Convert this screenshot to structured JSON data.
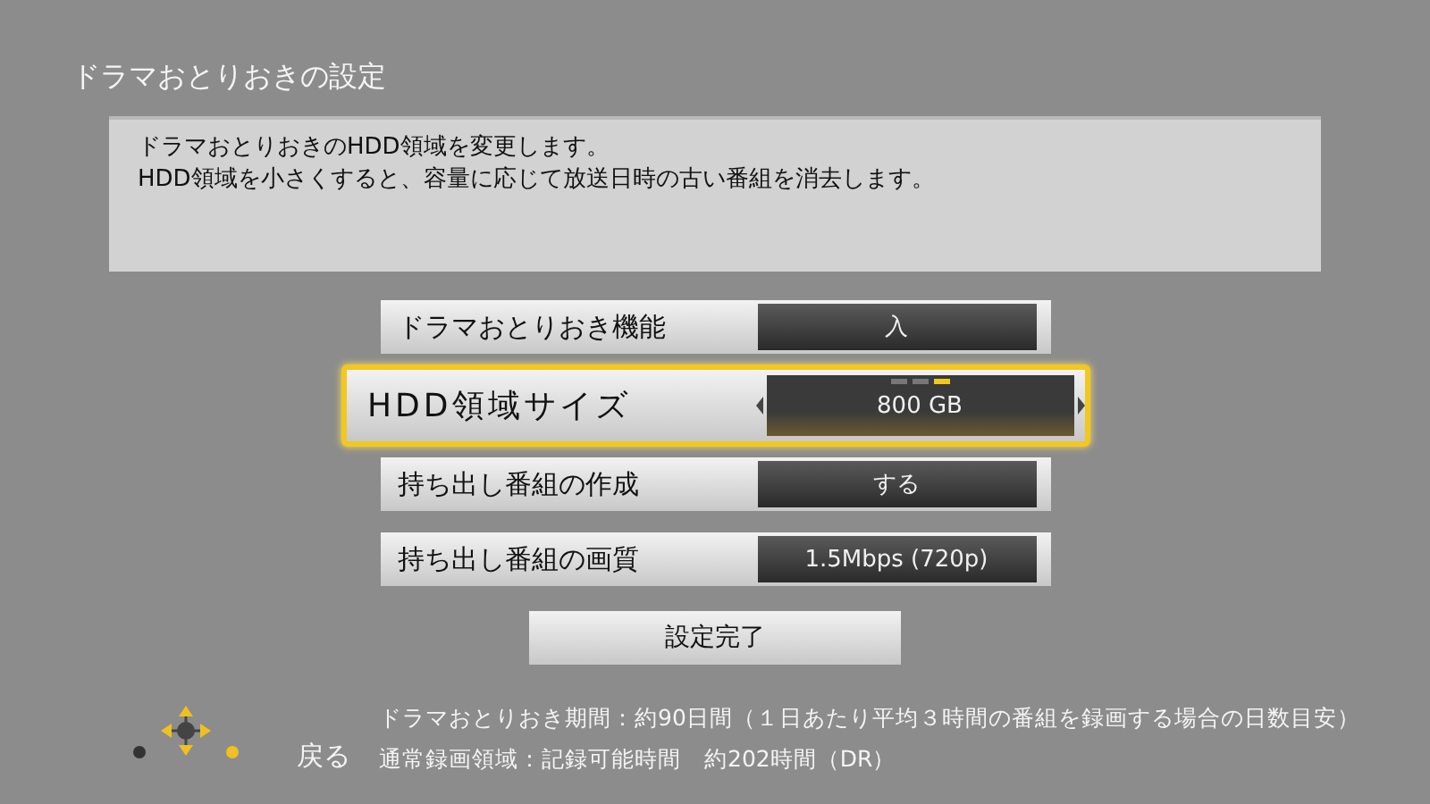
{
  "title": "ドラマおとりおきの設定",
  "description": [
    "ドラマおとりおきのHDD領域を変更します。",
    "HDD領域を小さくすると、容量に応じて放送日時の古い番組を消去します。"
  ],
  "settings": [
    {
      "label": "ドラマおとりおき機能",
      "value": "入",
      "selected": false
    },
    {
      "label": "HDD領域サイズ",
      "value": "800 GB",
      "selected": true,
      "pages": [
        {
          "selected": false
        },
        {
          "selected": false
        },
        {
          "selected": true
        }
      ]
    },
    {
      "label": "持ち出し番組の作成",
      "value": "する",
      "selected": false
    },
    {
      "label": "持ち出し番組の画質",
      "value": "1.5Mbps (720p)",
      "selected": false
    }
  ],
  "done_button": "設定完了",
  "back_label": "戻る",
  "info": [
    "ドラマおとりおき期間：約90日間（１日あたり平均３時間の番組を録画する場合の日数目安）",
    "通常録画領域：記録可能時間　約202時間（DR）"
  ]
}
